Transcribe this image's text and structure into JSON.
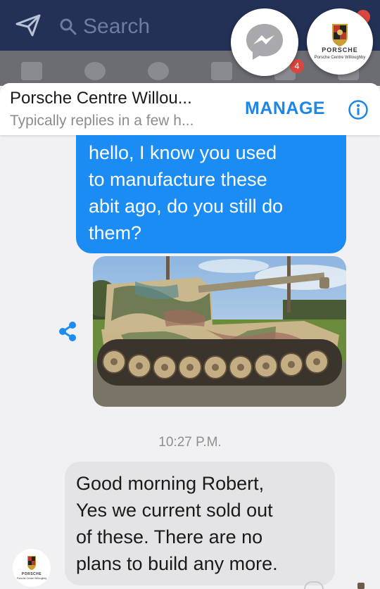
{
  "facebook_bar": {
    "search_placeholder": "Search",
    "send_icon": "paper-plane-icon",
    "search_icon": "search-icon"
  },
  "nav_row": {
    "notification_count": "4"
  },
  "chat_heads": {
    "messenger_icon": "messenger-icon",
    "porsche_wordmark": "PORSCHE",
    "porsche_subtitle": "Porsche Centre Willoughby"
  },
  "header": {
    "page_name": "Porsche Centre Willou...",
    "reply_time": "Typically replies in a few h...",
    "manage_label": "MANAGE",
    "info_icon": "info-icon"
  },
  "conversation": {
    "outgoing_lines": [
      "hello, I know you used",
      "to manufacture these",
      "abit ago, do you still do",
      "them?"
    ],
    "share_icon": "share-icon",
    "photo_subject": "tank-photo",
    "timestamp": "10:27 P.M.",
    "incoming_lines": [
      "Good morning Robert,",
      "Yes we current sold out",
      "of these. There are no",
      "plans to build any more."
    ]
  },
  "colors": {
    "facebook_bar": "#233156",
    "outgoing_bubble": "#1b8cf3",
    "incoming_bubble": "#e4e4e6",
    "manage_accent": "#1d86e6",
    "background": "#f1f1f3"
  }
}
